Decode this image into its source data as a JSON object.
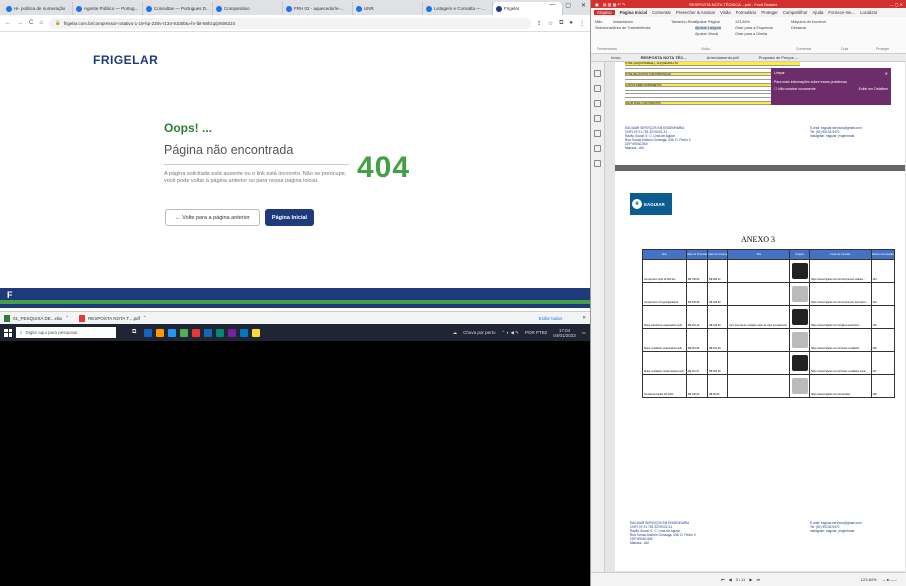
{
  "browser": {
    "tabs": [
      "Hi- política de numeração",
      "Agente Público — Portug...",
      "Consultas — Portugues D...",
      "Comparativo",
      "FRH 02 - aquecedor/e-...",
      "UNR",
      "Listagem e Consulta — ...",
      "Frigelar"
    ],
    "url": "frigelar.com.br/compressor-rotativo-1-19-hp-220v-r134-9100btu-hr-lbt-68hzq/p/606224",
    "window_controls": {
      "minimize": "—",
      "maximize": "▢",
      "close": "✕"
    }
  },
  "page": {
    "logo": "FRIGELAR",
    "oops": "Oops! ...",
    "heading": "Página não encontrada",
    "description": "A página solicitada está ausente ou o link está incorreto. Não se preocupe, você pode voltar à página anterior ou para nossa página inicial.",
    "code": "404",
    "back_button": "← Volte para a página anterior",
    "home_button": "Página Inicial",
    "footer_letter": "F"
  },
  "downloads": {
    "items": [
      "01_PESQUISA DE...xlsx",
      "RESPOSTA NOTA T....pdf"
    ],
    "show_all": "Exibir todos",
    "close": "✕"
  },
  "taskbar": {
    "search_placeholder": "Digite aqui para pesquisar",
    "weather": "Chuva por perto",
    "lang": "POR PTB2",
    "time": "17:04",
    "date": "04/01/2023",
    "icon_colors": [
      "#1565c0",
      "#ff9800",
      "#2196f3",
      "#4caf50",
      "#e53935",
      "#1565c0",
      "#00897b",
      "#7b1fa2",
      "#0277bd",
      "#fdd835"
    ]
  },
  "pdf": {
    "title": "RESPOSTA NOTA TÉCNICA ...pdf - Foxit Reader",
    "menu": [
      "Arquivo",
      "Página Inicial",
      "Comentar",
      "Preencher & Assinar",
      "Visão",
      "Formulário",
      "Proteger",
      "Compartilhar",
      "Ajuda",
      "Fornece-me...",
      "Localizar"
    ],
    "ribbon": {
      "tools": [
        "Mão",
        "Selecionar"
      ],
      "items": [
        "Instantâneo",
        "Área de Transferência",
        "Tamanho Real",
        "Ajustar Página",
        "Ajustar Largura",
        "Ajustar Visual",
        "Girar para a Esquerda",
        "Girar para a Direita",
        "Máquina de escrever",
        "Destacar"
      ],
      "zoom": "123,84%",
      "groups": [
        "Ferramentas",
        "Visão",
        "Comentar",
        "Criar",
        "Proteger"
      ]
    },
    "tabs": [
      "Início",
      "RESPOSTA NOTA TÉC...",
      "Arrendamento.pdf",
      "Proposta de Preços -..."
    ],
    "popup": {
      "header": "Limpar",
      "message": "Para mais informações sobre esses problemas",
      "option": "Não mostrar novamente",
      "link": "Exibir em Detalhes"
    },
    "top_rows": [
      "TOTAL (ALIQUOTA/REAL) - ALIQ DEVIDA 17%",
      "TOTAL DE CUSTOS COM TRIBUTAÇÃO",
      "CUSTOS DIRETOS/INDIRETOS",
      "VALOR FINAL COM TRIBUTOS"
    ],
    "address_left": [
      "EAGUIAR SERVIÇOS EM ENGENHARIA",
      "CNPJ Nº 21.753.327/0001-31",
      "Razão Social: E. C. Lima de Aguiar",
      "Rua Tomaz Antônio Gonzaga, 436, D. Pedro II",
      "CEP 69040-560",
      "Manaus - AM"
    ],
    "address_right": [
      "E-mail: eaguiar.servicos@gmail.com",
      "Tel: (92) 99133-9470",
      "Instagram: eaguiar_engenharia"
    ],
    "brand_name": "EAGUIAR",
    "anexo": "ANEXO 3",
    "table_headers": [
      "Item",
      "Valor de Proposta",
      "Valor de Compra",
      "Obs",
      "Imagem",
      "Fonte de consulta",
      "Número da cotação"
    ],
    "table_rows": [
      {
        "item": "Compressor split 12.000 btu",
        "v1": "R$ 709,00",
        "v2": "R$ 686,12",
        "obs": "",
        "source": "https://www.frigelar.com.br/compressor-rotativo...",
        "num": "123"
      },
      {
        "item": "Compressor 1/4 gelo/geladeira",
        "v1": "R$ 328,95",
        "v2": "R$ 326,00",
        "obs": "",
        "source": "https://www.frigelar.com.br/compressor-hermetico...",
        "num": "124"
      },
      {
        "item": "Placa eletrônica evaporadora split",
        "v1": "R$ 219,13",
        "v2": "R$ 219,00",
        "obs": "Item precisa de cotação maior de valor previamente",
        "source": "https://www.frigelar.com.br/placa-eletronica...",
        "num": "125"
      },
      {
        "item": "Motor ventilador evaporadora split",
        "v1": "R$ 261,85",
        "v2": "R$ 231,46",
        "obs": "",
        "source": "https://www.frigelar.com.br/motor-ventilador...",
        "num": "126"
      },
      {
        "item": "Motor ventilador condensadora split",
        "v1": "R$ 161,07",
        "v2": "R$ 186,06",
        "obs": "",
        "source": "https://www.frigelar.com.br/motor-ventilador-cond...",
        "num": "127"
      },
      {
        "item": "Contatora tripolar 9A 220V",
        "v1": "R$ 106,02",
        "v2": "R$ 99,00",
        "obs": "",
        "source": "https://www.frigelar.com.br/contator...",
        "num": "128"
      }
    ],
    "status": {
      "page": "3 / 11",
      "zoom": "123,84%"
    }
  }
}
